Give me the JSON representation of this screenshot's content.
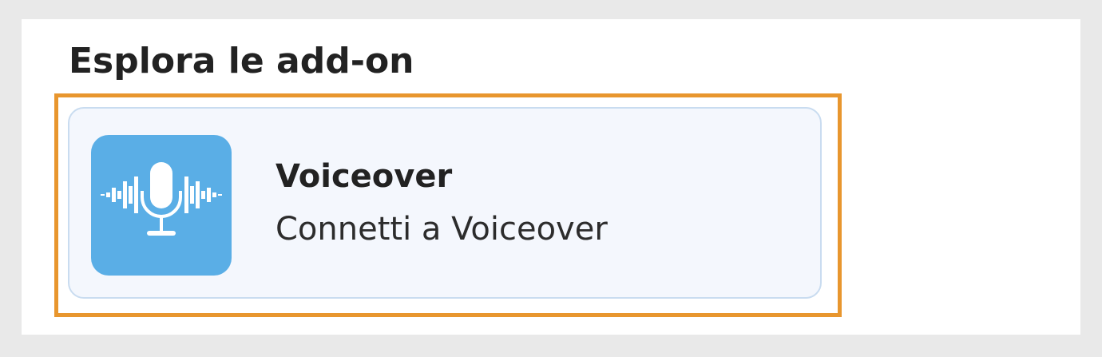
{
  "section": {
    "title": "Esplora le add-on"
  },
  "addon": {
    "name": "Voiceover",
    "description": "Connetti a Voiceover",
    "icon": "microphone-waveform-icon"
  },
  "colors": {
    "highlight_border": "#e8962e",
    "card_background": "#f4f7fd",
    "card_border": "#c9dcf0",
    "icon_background": "#5aaee6"
  }
}
